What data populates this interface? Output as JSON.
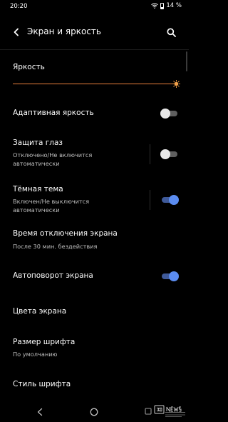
{
  "status_bar": {
    "time": "20:20",
    "battery": "14 %"
  },
  "header": {
    "title": "Экран и яркость",
    "back_icon": "arrow-left-icon",
    "search_icon": "search-icon"
  },
  "brightness": {
    "title": "Яркость",
    "level": 1.0,
    "accent_color": "#E8803C"
  },
  "settings": {
    "adaptive": {
      "title": "Адаптивная яркость",
      "enabled": false
    },
    "eye_protection": {
      "title": "Защита глаз",
      "subtitle_line1": "Отключено/Не включится",
      "subtitle_line2": "автоматически",
      "enabled": false
    },
    "dark_theme": {
      "title": "Тёмная тема",
      "subtitle_line1": "Включен/Не выключится",
      "subtitle_line2": "автоматически",
      "enabled": true
    },
    "screen_timeout": {
      "title": "Время отключения экрана",
      "subtitle": "После 30 мин. бездействия"
    },
    "auto_rotate": {
      "title": "Автоповорот экрана",
      "enabled": true
    },
    "screen_colors": {
      "title": "Цвета экрана"
    },
    "font_size": {
      "title": "Размер шрифта",
      "subtitle": "По умолчанию"
    },
    "font_style": {
      "title": "Стиль шрифта"
    }
  },
  "colors": {
    "toggle_on": "#5B8CF0",
    "toggle_off": "#E9E9E9",
    "background": "#000000"
  },
  "nav": {
    "back_icon": "triangle-back-icon",
    "home_icon": "circle-home-icon",
    "recent_icon": "square-recent-icon"
  },
  "watermark": {
    "logo": "3DNews",
    "tagline": "Daily Digital Digest"
  }
}
